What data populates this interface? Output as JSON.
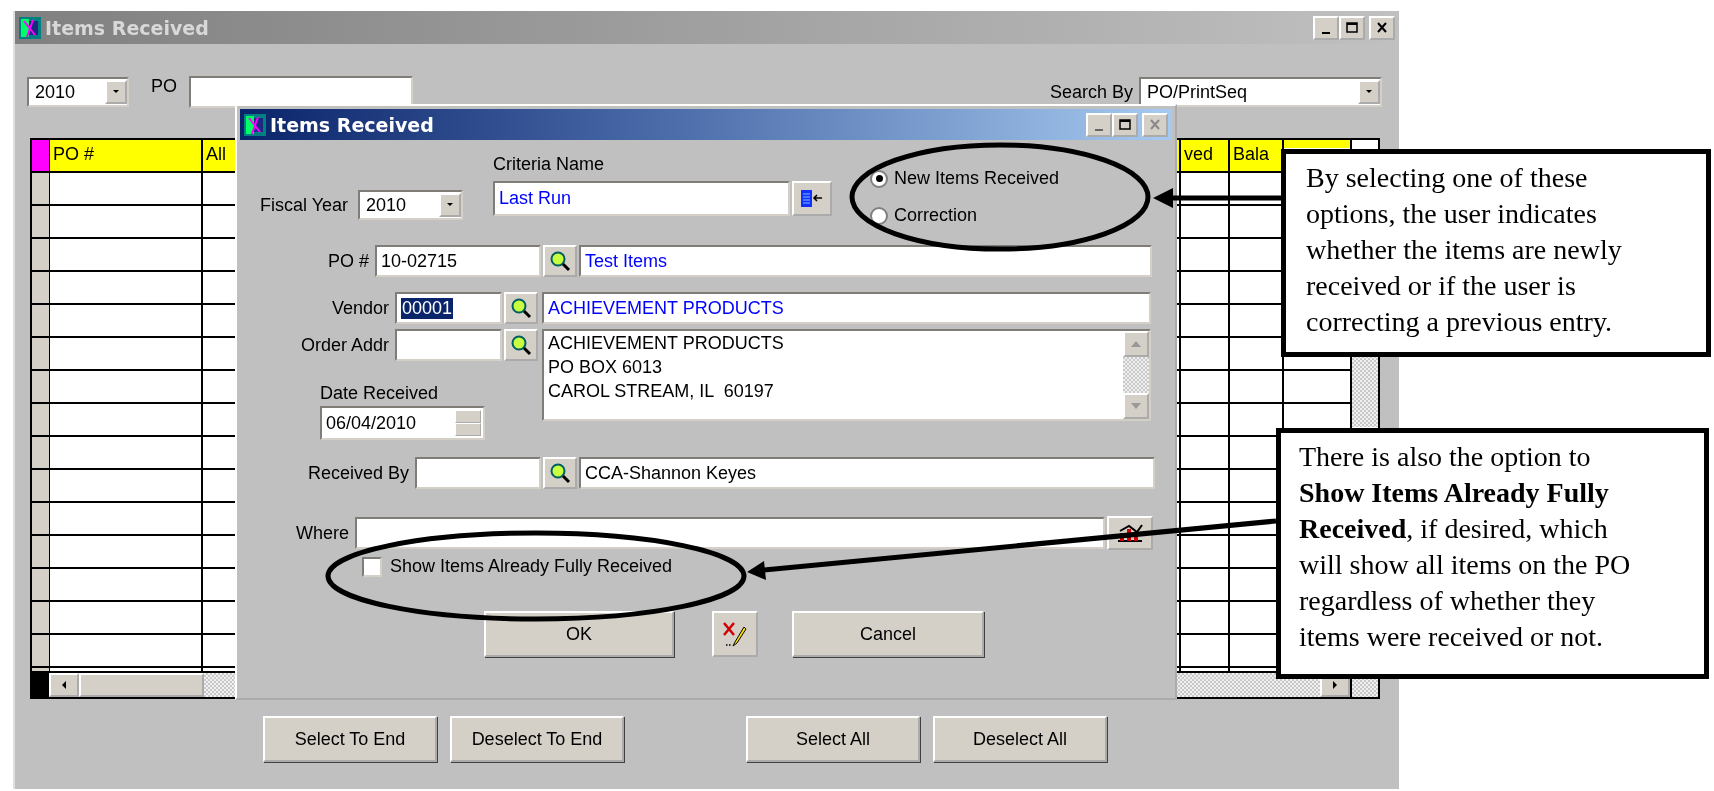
{
  "main_window": {
    "title": "Items Received",
    "year": "2010",
    "po_label": "PO",
    "search_by_label": "Search By",
    "search_by": "PO/PrintSeq",
    "columns": [
      {
        "label": "PO #",
        "kind": "text"
      },
      {
        "label": "All",
        "kind": "text"
      },
      {
        "label": "ved",
        "kind": "text"
      },
      {
        "label": "Bala",
        "kind": "text"
      }
    ],
    "buttons": [
      "Select To End",
      "Deselect To End",
      "Select All",
      "Deselect All"
    ]
  },
  "dialog": {
    "title": "Items Received",
    "fiscal_year_label": "Fiscal Year",
    "fiscal_year": "2010",
    "criteria_name_label": "Criteria Name",
    "criteria_name": "Last Run",
    "options": [
      {
        "label": "New Items Received",
        "selected": true
      },
      {
        "label": "Correction",
        "selected": false
      }
    ],
    "po_label": "PO #",
    "po_number": "10-02715",
    "po_description": "Test Items",
    "vendor_label": "Vendor",
    "vendor_code": "00001",
    "vendor_code_highlighted": true,
    "vendor_name": "ACHIEVEMENT PRODUCTS",
    "order_addr_label": "Order Addr",
    "address_lines": [
      "ACHIEVEMENT PRODUCTS",
      "PO BOX 6013",
      "CAROL STREAM, IL  60197"
    ],
    "date_received_label": "Date Received",
    "date_received": "06/04/2010",
    "received_by_label": "Received By",
    "received_by_name": "CCA-Shannon Keyes",
    "where_label": "Where",
    "show_fully_received": {
      "label": "Show Items Already Fully Received",
      "checked": false
    },
    "buttons": [
      "OK",
      "Cancel"
    ]
  },
  "callouts": [
    {
      "text": "By selecting one of these options, the user indicates whether the items are newly received or if the user is correcting a previous entry."
    },
    {
      "text": "There is also the option to **Show Items Already Fully Received**, if desired, which will show all items on the PO regardless of whether they items were received or not."
    }
  ]
}
